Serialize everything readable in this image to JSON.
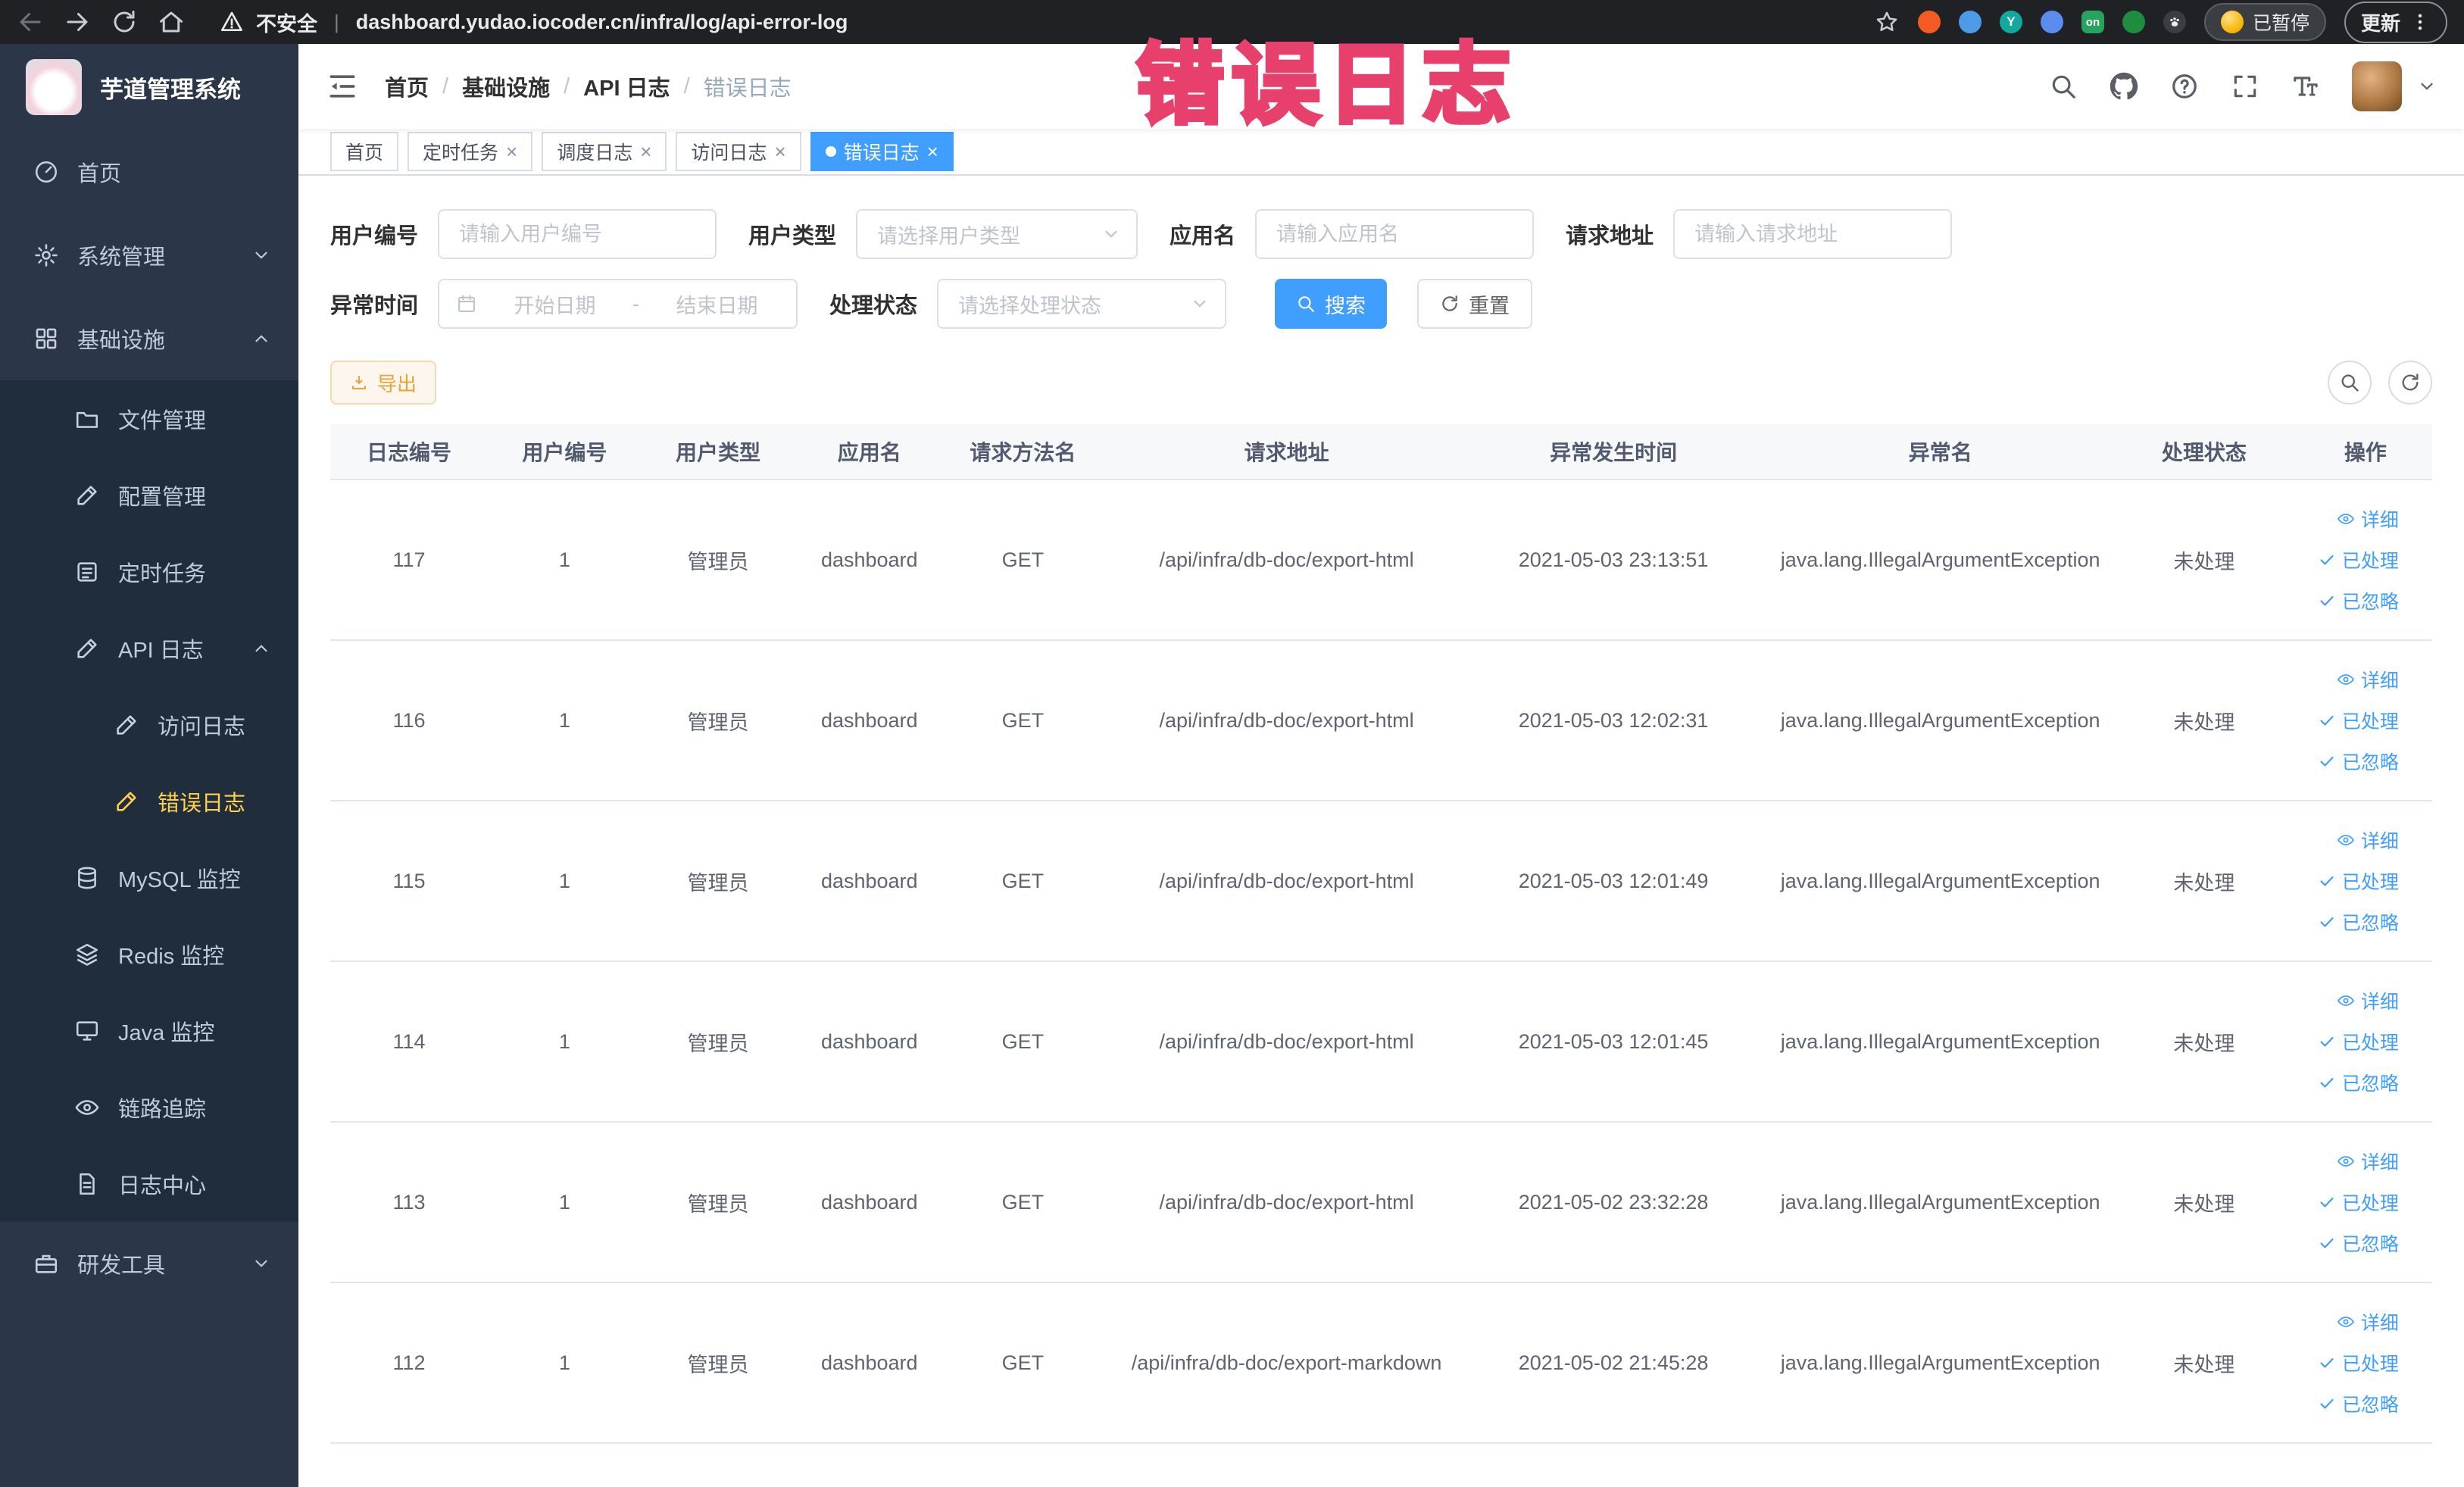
{
  "browser": {
    "security_label": "不安全",
    "url": "dashboard.yudao.iocoder.cn/infra/log/api-error-log",
    "paused_badge": "已暂停",
    "update_label": "更新",
    "extension_badges": {
      "y": "Y",
      "on": "on"
    }
  },
  "annotation": {
    "text": "错误日志",
    "color": "#e8406c"
  },
  "sidebar": {
    "logo_title": "芋道管理系统",
    "items": [
      {
        "label": "首页"
      },
      {
        "label": "系统管理"
      },
      {
        "label": "基础设施"
      },
      {
        "label": "文件管理"
      },
      {
        "label": "配置管理"
      },
      {
        "label": "定时任务"
      },
      {
        "label": "API 日志"
      },
      {
        "label": "访问日志"
      },
      {
        "label": "错误日志"
      },
      {
        "label": "MySQL 监控"
      },
      {
        "label": "Redis 监控"
      },
      {
        "label": "Java 监控"
      },
      {
        "label": "链路追踪"
      },
      {
        "label": "日志中心"
      },
      {
        "label": "研发工具"
      }
    ]
  },
  "header": {
    "breadcrumb": [
      {
        "label": "首页"
      },
      {
        "label": "基础设施"
      },
      {
        "label": "API 日志"
      },
      {
        "label": "错误日志"
      }
    ]
  },
  "tabs": [
    {
      "label": "首页"
    },
    {
      "label": "定时任务"
    },
    {
      "label": "调度日志"
    },
    {
      "label": "访问日志"
    },
    {
      "label": "错误日志"
    }
  ],
  "filters": {
    "user_id_label": "用户编号",
    "user_id_placeholder": "请输入用户编号",
    "user_type_label": "用户类型",
    "user_type_placeholder": "请选择用户类型",
    "app_name_label": "应用名",
    "app_name_placeholder": "请输入应用名",
    "request_url_label": "请求地址",
    "request_url_placeholder": "请输入请求地址",
    "exception_time_label": "异常时间",
    "date_start_placeholder": "开始日期",
    "date_separator": "-",
    "date_end_placeholder": "结束日期",
    "process_status_label": "处理状态",
    "process_status_placeholder": "请选择处理状态",
    "search_button": "搜索",
    "reset_button": "重置"
  },
  "toolbar": {
    "export_button": "导出"
  },
  "table": {
    "columns": [
      "日志编号",
      "用户编号",
      "用户类型",
      "应用名",
      "请求方法名",
      "请求地址",
      "异常发生时间",
      "异常名",
      "处理状态",
      "操作"
    ],
    "action_detail": "详细",
    "action_processed": "已处理",
    "action_ignored": "已忽略",
    "rows": [
      {
        "id": "117",
        "user_id": "1",
        "user_type": "管理员",
        "app": "dashboard",
        "method": "GET",
        "url": "/api/infra/db-doc/export-html",
        "time": "2021-05-03 23:13:51",
        "exception": "java.lang.IllegalArgumentException",
        "status": "未处理"
      },
      {
        "id": "116",
        "user_id": "1",
        "user_type": "管理员",
        "app": "dashboard",
        "method": "GET",
        "url": "/api/infra/db-doc/export-html",
        "time": "2021-05-03 12:02:31",
        "exception": "java.lang.IllegalArgumentException",
        "status": "未处理"
      },
      {
        "id": "115",
        "user_id": "1",
        "user_type": "管理员",
        "app": "dashboard",
        "method": "GET",
        "url": "/api/infra/db-doc/export-html",
        "time": "2021-05-03 12:01:49",
        "exception": "java.lang.IllegalArgumentException",
        "status": "未处理"
      },
      {
        "id": "114",
        "user_id": "1",
        "user_type": "管理员",
        "app": "dashboard",
        "method": "GET",
        "url": "/api/infra/db-doc/export-html",
        "time": "2021-05-03 12:01:45",
        "exception": "java.lang.IllegalArgumentException",
        "status": "未处理"
      },
      {
        "id": "113",
        "user_id": "1",
        "user_type": "管理员",
        "app": "dashboard",
        "method": "GET",
        "url": "/api/infra/db-doc/export-html",
        "time": "2021-05-02 23:32:28",
        "exception": "java.lang.IllegalArgumentException",
        "status": "未处理"
      },
      {
        "id": "112",
        "user_id": "1",
        "user_type": "管理员",
        "app": "dashboard",
        "method": "GET",
        "url": "/api/infra/db-doc/export-markdown",
        "time": "2021-05-02 21:45:28",
        "exception": "java.lang.IllegalArgumentException",
        "status": "未处理"
      }
    ]
  },
  "glyphs": {
    "close": "×",
    "slash": "/",
    "pipe": "|"
  }
}
